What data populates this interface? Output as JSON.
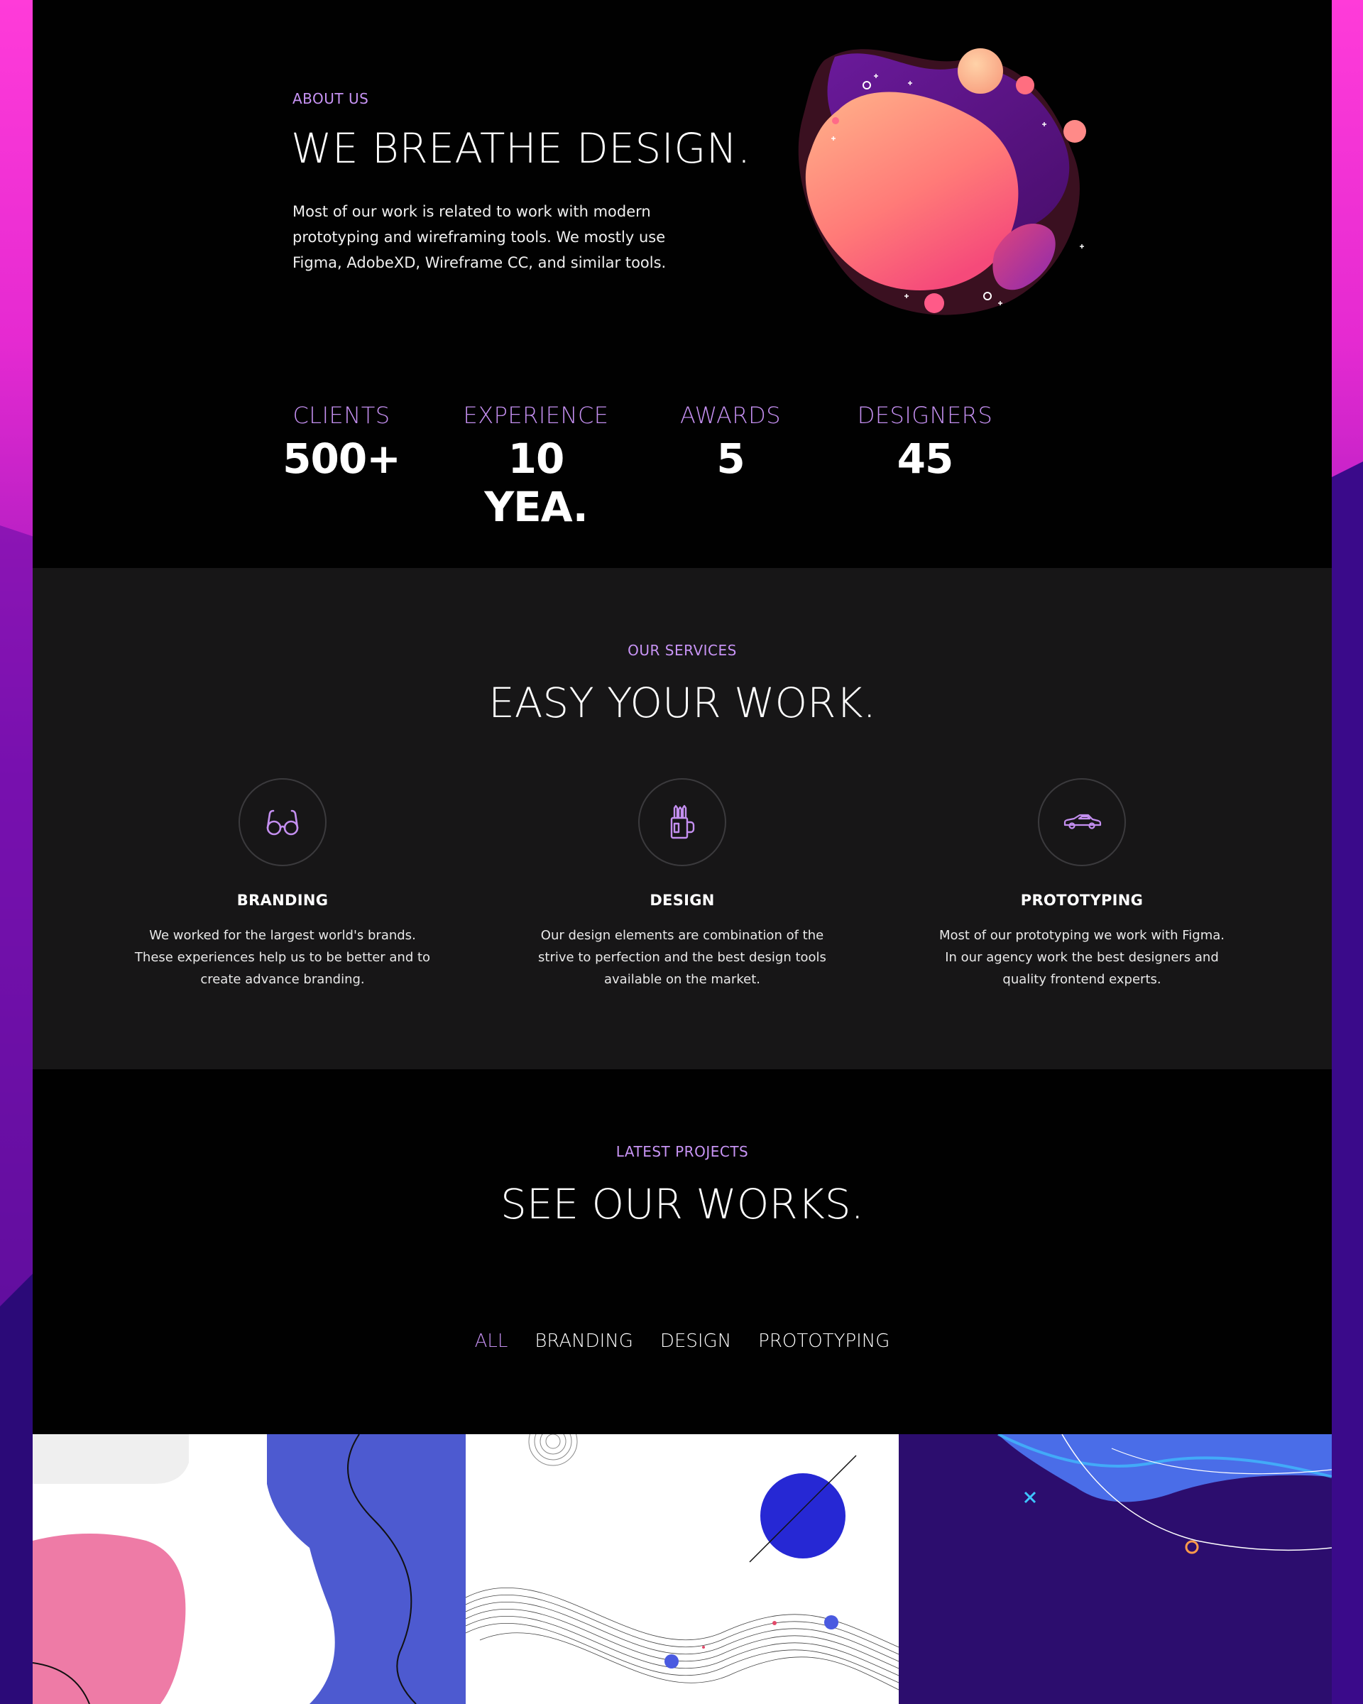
{
  "about": {
    "eyebrow": "ABOUT US",
    "title": "WE BREATHE DESIGN.",
    "text": "Most of our work is related to work with modern prototyping and wireframing tools. We mostly use Figma, AdobeXD, Wireframe CC, and similar tools."
  },
  "stats": [
    {
      "label": "CLIENTS",
      "value": "500+"
    },
    {
      "label": "EXPERIENCE",
      "value": "10 YEA."
    },
    {
      "label": "AWARDS",
      "value": "5"
    },
    {
      "label": "DESIGNERS",
      "value": "45"
    }
  ],
  "services": {
    "eyebrow": "OUR SERVICES",
    "title": "EASY YOUR WORK.",
    "items": [
      {
        "icon": "glasses-icon",
        "title": "BRANDING",
        "text": "We worked for the largest world's brands. These experiences help us to be better and to create advance branding."
      },
      {
        "icon": "pencil-mug-icon",
        "title": "DESIGN",
        "text": "Our design elements are combination of the strive to perfection and the best design tools available on the market."
      },
      {
        "icon": "car-icon",
        "title": "PROTOTYPING",
        "text": "Most of our prototyping we work with Figma. In our agency work the best designers and quality frontend experts."
      }
    ]
  },
  "projects": {
    "eyebrow": "LATEST PROJECTS",
    "title": "SEE OUR WORKS.",
    "filters": [
      "ALL",
      "BRANDING",
      "DESIGN",
      "PROTOTYPING"
    ],
    "active_filter": "ALL"
  },
  "colors": {
    "accent": "#c48ff0",
    "dark": "#010101",
    "panel": "#171617",
    "brand_pink": "#ff33d6",
    "brand_purple": "#3a0c8c"
  }
}
